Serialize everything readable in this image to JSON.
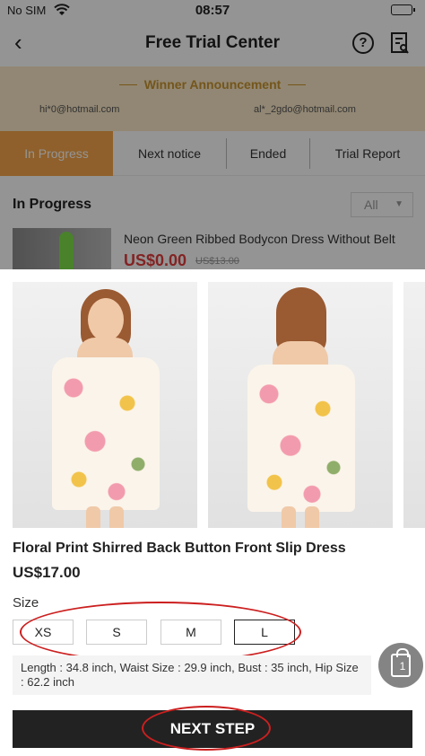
{
  "status_bar": {
    "carrier": "No SIM",
    "time": "08:57",
    "wifi_icon": "wifi-icon",
    "battery_icon": "battery-icon"
  },
  "nav": {
    "title": "Free Trial Center",
    "back_icon": "back-icon",
    "help_icon": "help-icon",
    "report_icon": "report-icon"
  },
  "winner": {
    "title": "Winner Announcement",
    "entries": [
      "hi*0@hotmail.com",
      "al*_2gdo@hotmail.com"
    ]
  },
  "tabs": [
    {
      "label": "In Progress",
      "active": true
    },
    {
      "label": "Next notice",
      "active": false
    },
    {
      "label": "Ended",
      "active": false
    },
    {
      "label": "Trial Report",
      "active": false
    }
  ],
  "section": {
    "title": "In Progress",
    "filter_value": "All"
  },
  "list_product": {
    "name": "Neon Green Ribbed Bodycon Dress Without Belt",
    "price": "US$0.00",
    "old_price": "US$13.00"
  },
  "sheet": {
    "product_name": "Floral Print Shirred Back Button Front Slip Dress",
    "price": "US$17.00",
    "size_label": "Size",
    "sizes": [
      {
        "label": "XS",
        "selected": false
      },
      {
        "label": "S",
        "selected": false
      },
      {
        "label": "M",
        "selected": false
      },
      {
        "label": "L",
        "selected": true
      }
    ],
    "measurements": "Length : 34.8 inch, Waist Size : 29.9 inch, Bust : 35 inch, Hip Size : 62.2 inch",
    "bag_count": "1",
    "next_step_label": "NEXT STEP"
  },
  "colors": {
    "accent_tab": "#f7a64a",
    "winner_gold": "#c8942f",
    "price_red": "#e23d3d",
    "annotation_red": "#cc1f1f"
  }
}
